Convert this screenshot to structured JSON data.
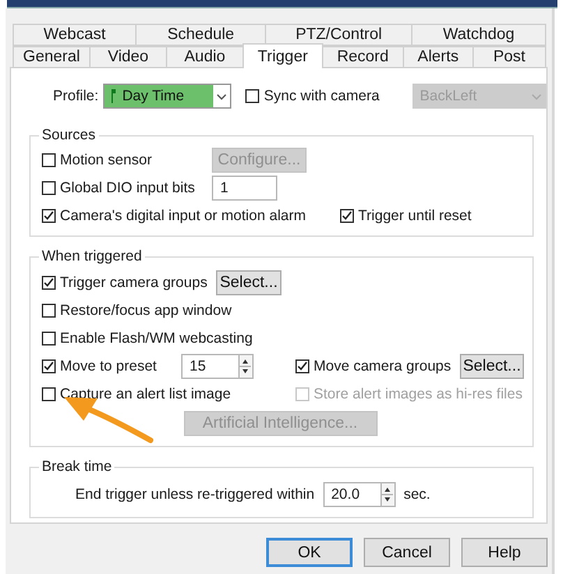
{
  "tabs_row_1": [
    {
      "label": "Webcast",
      "selected": false
    },
    {
      "label": "Schedule",
      "selected": false
    },
    {
      "label": "PTZ/Control",
      "selected": false
    },
    {
      "label": "Watchdog",
      "selected": false
    }
  ],
  "tabs_row_2": [
    {
      "label": "General",
      "selected": false
    },
    {
      "label": "Video",
      "selected": false
    },
    {
      "label": "Audio",
      "selected": false
    },
    {
      "label": "Trigger",
      "selected": true
    },
    {
      "label": "Record",
      "selected": false
    },
    {
      "label": "Alerts",
      "selected": false
    },
    {
      "label": "Post",
      "selected": false
    }
  ],
  "profile": {
    "label": "Profile:",
    "value": "Day Time"
  },
  "sync": {
    "label": "Sync with camera",
    "checked": false
  },
  "camera": {
    "value": "BackLeft",
    "disabled": true
  },
  "sources": {
    "title": "Sources",
    "motion_sensor": {
      "label": "Motion sensor",
      "checked": false
    },
    "configure_button": {
      "label": "Configure...",
      "disabled": true
    },
    "dio": {
      "label": "Global DIO input bits",
      "checked": false,
      "value": "1"
    },
    "camera_input": {
      "label": "Camera's digital input or motion alarm",
      "checked": true
    },
    "until_reset": {
      "label": "Trigger until reset",
      "checked": true
    }
  },
  "when_triggered": {
    "title": "When triggered",
    "trigger_groups": {
      "label": "Trigger camera groups",
      "checked": true
    },
    "trigger_select": {
      "label": "Select...",
      "disabled": false
    },
    "restore": {
      "label": "Restore/focus app window",
      "checked": false
    },
    "flash": {
      "label": "Enable Flash/WM webcasting",
      "checked": false
    },
    "preset": {
      "label": "Move to preset",
      "checked": true,
      "value": "15"
    },
    "move_groups": {
      "label": "Move camera groups",
      "checked": true
    },
    "move_select": {
      "label": "Select...",
      "disabled": false
    },
    "capture": {
      "label": "Capture an alert list image",
      "checked": false
    },
    "hires": {
      "label": "Store alert images as hi-res files",
      "checked": false,
      "disabled": true
    },
    "ai_button": {
      "label": "Artificial Intelligence...",
      "disabled": true
    }
  },
  "break_time": {
    "title": "Break time",
    "label": "End trigger unless re-triggered within",
    "value": "20.0",
    "unit": "sec."
  },
  "buttons": [
    {
      "label": "OK",
      "default": true
    },
    {
      "label": "Cancel",
      "default": false
    },
    {
      "label": "Help",
      "default": false
    }
  ]
}
